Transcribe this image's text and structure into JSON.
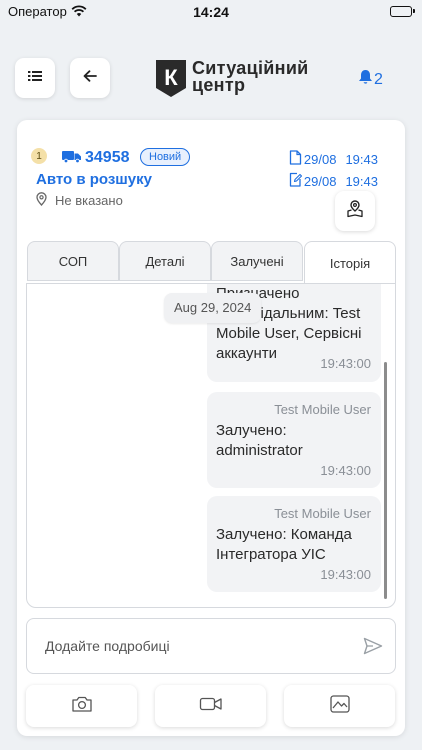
{
  "status_bar": {
    "carrier": "Оператор",
    "time": "14:24"
  },
  "header": {
    "menu_icon": "list-icon",
    "back_icon": "arrow-left-icon",
    "logo": {
      "line1": "Ситуаційний",
      "line2": "центр",
      "mark_letter": "К"
    },
    "notifications": {
      "icon": "bell-icon",
      "count": "2"
    }
  },
  "incident": {
    "priority": "1",
    "type_icon": "truck-icon",
    "number": "34958",
    "status": "Новий",
    "title": "Авто в розшуку",
    "location": "Не вказано",
    "created": {
      "date": "29/08",
      "time": "19:43"
    },
    "edited": {
      "date": "29/08",
      "time": "19:43"
    }
  },
  "tabs": [
    {
      "label": "СОП"
    },
    {
      "label": "Деталі"
    },
    {
      "label": "Залучені"
    },
    {
      "label": "Історія"
    }
  ],
  "history": {
    "date_chip": "Aug 29, 2024",
    "messages": [
      {
        "author": "",
        "text_lines": [
          "Призначено",
          "відповідальним: Test",
          "Mobile User, Сервісні",
          "аккаунти"
        ],
        "time": "19:43:00"
      },
      {
        "author": "Test Mobile User",
        "text_lines": [
          "Залучено:",
          "administrator"
        ],
        "time": "19:43:00"
      },
      {
        "author": "Test Mobile User",
        "text_lines": [
          "Залучено: Команда",
          "Інтегратора УІС"
        ],
        "time": "19:43:00"
      }
    ]
  },
  "composer": {
    "placeholder": "Додайте подробиці",
    "send_icon": "send-icon"
  },
  "actions": [
    {
      "icon": "camera-icon"
    },
    {
      "icon": "video-icon"
    },
    {
      "icon": "image-icon"
    }
  ],
  "colors": {
    "accent": "#1f6fe0",
    "background": "#eef1f4",
    "bubble": "#f2f3f5"
  }
}
